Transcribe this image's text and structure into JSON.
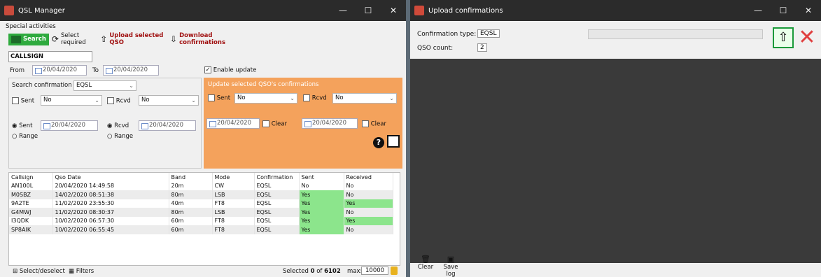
{
  "qsl": {
    "title": "QSL Manager",
    "special": "Special activities",
    "toolbar": {
      "search": "Search",
      "select_required": "Select required",
      "upload": "Upload selected QSO",
      "download": "Download confirmations"
    },
    "callsign": "CALLSIGN",
    "from_label": "From",
    "to_label": "To",
    "from_date": "20/04/2020",
    "to_date": "20/04/2020",
    "enable_update": "Enable update",
    "search_conf_label": "Search confirmation",
    "search_conf_value": "EQSL",
    "sent_label": "Sent",
    "sent_value": "No",
    "rcvd_label": "Rcvd",
    "rcvd_value": "No",
    "sent_date": "20/04/2020",
    "rcvd_date": "20/04/2020",
    "range_label": "Range",
    "update_title": "Update selected QSO's confirmations",
    "upd_sent_value": "No",
    "upd_rcvd_value": "No",
    "upd_sent_date": "20/04/2020",
    "upd_rcvd_date": "20/04/2020",
    "clear_label": "Clear",
    "headers": [
      "Callsign",
      "Qso Date",
      "Band",
      "Mode",
      "Confirmation",
      "Sent",
      "Received"
    ],
    "rows": [
      [
        "AN100L",
        "20/04/2020 14:49:58",
        "20m",
        "CW",
        "EQSL",
        "No",
        "No"
      ],
      [
        "M0SBZ",
        "14/02/2020 08:51:38",
        "80m",
        "LSB",
        "EQSL",
        "Yes",
        "No"
      ],
      [
        "9A2TE",
        "11/02/2020 23:55:30",
        "40m",
        "FT8",
        "EQSL",
        "Yes",
        "Yes"
      ],
      [
        "G4MWJ",
        "11/02/2020 08:30:37",
        "80m",
        "LSB",
        "EQSL",
        "Yes",
        "No"
      ],
      [
        "I3QDK",
        "10/02/2020 06:57:30",
        "60m",
        "FT8",
        "EQSL",
        "Yes",
        "Yes"
      ],
      [
        "SP8AIK",
        "10/02/2020 06:55:45",
        "60m",
        "FT8",
        "EQSL",
        "Yes",
        "No"
      ]
    ],
    "select_deselect": "Select/deselect",
    "filters": "Filters",
    "selected_label": "Selected",
    "selected_count": "0",
    "of_label": "of",
    "total_count": "6102",
    "max_label": "max:",
    "max_value": "10000"
  },
  "upload": {
    "title": "Upload confirmations",
    "conf_type_label": "Confirmation type:",
    "conf_type_value": "EQSL",
    "qso_count_label": "QSO count:",
    "qso_count_value": "2",
    "clear": "Clear",
    "save_log": "Save log"
  },
  "colors": {
    "orange": "#f4a25c",
    "green_yes": "#8ce58c",
    "search_btn": "#2eaa3e",
    "titlebar": "#2b2b2b",
    "log_bg": "#3a3a3a"
  },
  "icons": [
    "app-icon",
    "refresh-icon",
    "upload-icon",
    "download-icon",
    "help-icon",
    "save-icon",
    "lock-icon",
    "trash-icon",
    "close-icon"
  ]
}
